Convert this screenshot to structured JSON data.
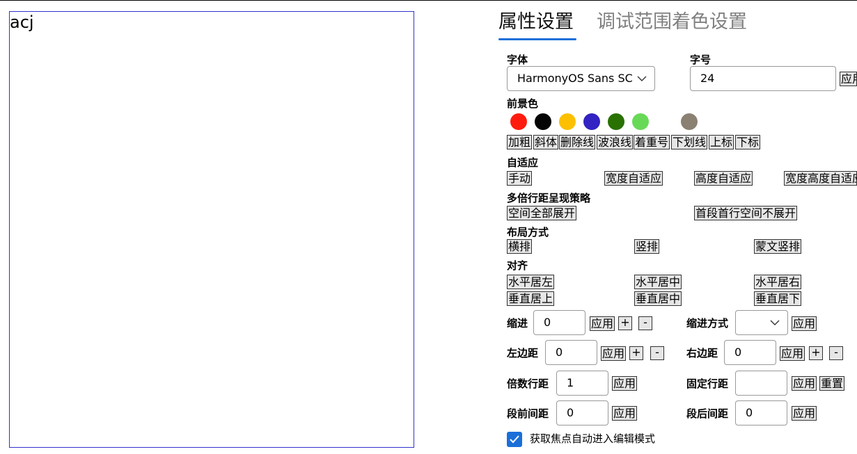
{
  "editor": {
    "text": "acj"
  },
  "tabs": [
    {
      "label": "属性设置",
      "active": true
    },
    {
      "label": "调试范围着色设置",
      "active": false
    }
  ],
  "font": {
    "label": "字体",
    "value": "HarmonyOS Sans SC"
  },
  "font_size": {
    "label": "字号",
    "value": "24",
    "apply": "应用"
  },
  "fg_color": {
    "label": "前景色",
    "colors": [
      "#ff1c0e",
      "#050505",
      "#fcc000",
      "#3223c2",
      "#297100",
      "#68d957",
      "#8b8172"
    ]
  },
  "style_buttons": [
    "加粗",
    "斜体",
    "删除线",
    "波浪线",
    "着重号",
    "下划线",
    "上标",
    "下标"
  ],
  "adapt": {
    "label": "自适应",
    "options": [
      "手动",
      "宽度自适应",
      "高度自适应",
      "宽度高度自适应"
    ]
  },
  "line_spacing_strategy": {
    "label": "多倍行距呈现策略",
    "options": [
      "空间全部展开",
      "首段首行空间不展开"
    ]
  },
  "layout": {
    "label": "布局方式",
    "options": [
      "横排",
      "竖排",
      "蒙文竖排"
    ]
  },
  "align": {
    "label": "对齐",
    "row1": [
      "水平居左",
      "水平居中",
      "水平居右"
    ],
    "row2": [
      "垂直居上",
      "垂直居中",
      "垂直居下"
    ]
  },
  "indent": {
    "label": "缩进",
    "value": "0",
    "apply": "应用",
    "plus": "+",
    "minus": "-"
  },
  "indent_mode": {
    "label": "缩进方式",
    "value": "",
    "apply": "应用"
  },
  "left_margin": {
    "label": "左边距",
    "value": "0",
    "apply": "应用",
    "plus": "+",
    "minus": "-"
  },
  "right_margin": {
    "label": "右边距",
    "value": "0",
    "apply": "应用",
    "plus": "+",
    "minus": "-"
  },
  "multi_spacing": {
    "label": "倍数行距",
    "value": "1",
    "apply": "应用"
  },
  "fixed_spacing": {
    "label": "固定行距",
    "value": "",
    "apply": "应用",
    "reset": "重置"
  },
  "space_before": {
    "label": "段前间距",
    "value": "0",
    "apply": "应用"
  },
  "space_after": {
    "label": "段后间距",
    "value": "0",
    "apply": "应用"
  },
  "auto_edit": {
    "label": "获取焦点自动进入编辑模式",
    "checked": true
  }
}
